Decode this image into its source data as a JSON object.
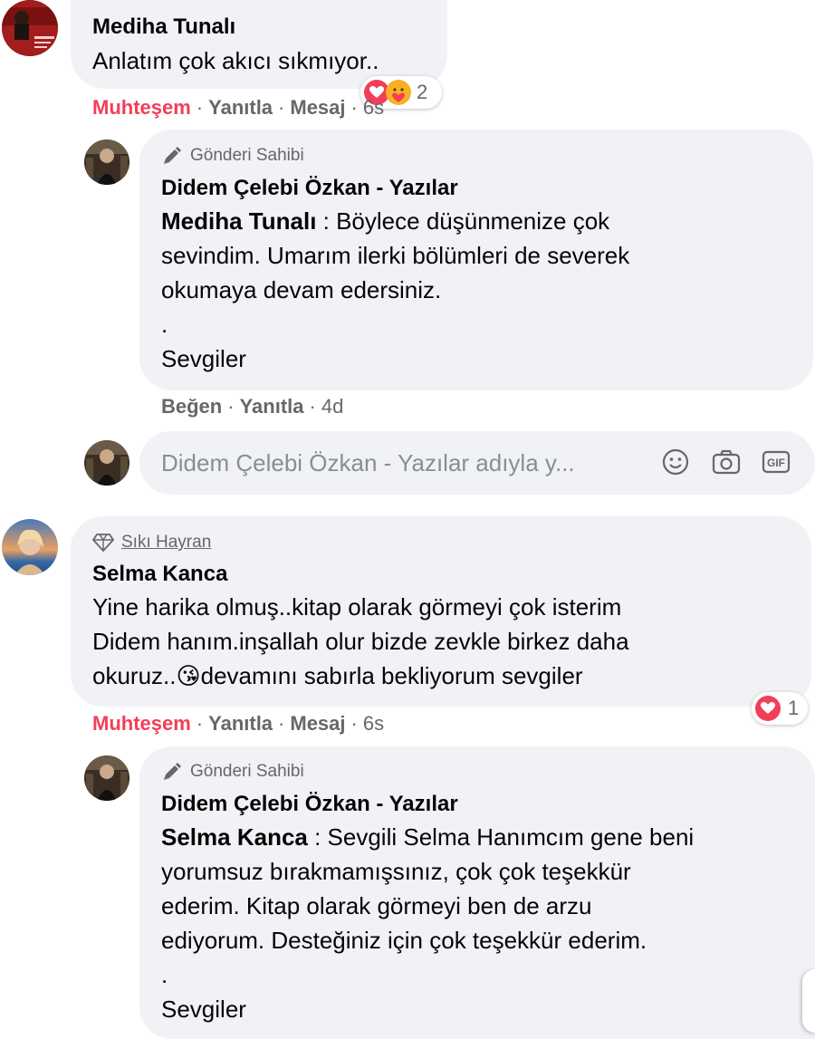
{
  "comments": [
    {
      "author": "Mediha Tunalı",
      "text": [
        "Anlatım çok akıcı sıkmıyor.."
      ],
      "actions": {
        "like": "Muhteşem",
        "reply": "Yanıtla",
        "message": "Mesaj",
        "time": "6s"
      },
      "reaction_count": "2",
      "reaction_icons": [
        "love-icon",
        "care-icon"
      ],
      "reply": {
        "badge": "Gönderi Sahibi",
        "author": "Didem Çelebi Özkan - Yazılar",
        "mention": "Mediha Tunalı",
        "lines": [
          " : Böylece düşünmenize çok",
          "sevindim. Umarım ilerki bölümleri de severek",
          "okumaya devam edersiniz.",
          ".",
          "Sevgiler"
        ],
        "actions": {
          "like": "Beğen",
          "reply": "Yanıtla",
          "time": "4d"
        }
      },
      "composer": {
        "placeholder": "Didem Çelebi Özkan - Yazılar adıyla y...",
        "icons": [
          "emoji-icon",
          "camera-icon",
          "gif-icon"
        ],
        "gif_label": "GIF"
      }
    },
    {
      "author": "Selma Kanca",
      "badge": "Sıkı Hayran",
      "text": [
        "Yine harika olmuş..kitap olarak görmeyi çok isterim",
        "Didem hanım.inşallah olur bizde zevkle birkez daha",
        "okuruz..",
        "devamını sabırla bekliyorum sevgiler"
      ],
      "emoji": "😘",
      "actions": {
        "like": "Muhteşem",
        "reply": "Yanıtla",
        "message": "Mesaj",
        "time": "6s"
      },
      "reaction_count": "1",
      "reaction_icons": [
        "love-icon"
      ],
      "reply": {
        "badge": "Gönderi Sahibi",
        "author": "Didem Çelebi Özkan - Yazılar",
        "mention": "Selma Kanca",
        "lines": [
          " : Sevgili Selma Hanımcım gene beni",
          "yorumsuz bırakmamışsınız, çok çok teşekkür",
          "ederim. Kitap olarak görmeyi ben de arzu",
          "ediyorum. Desteğiniz için çok teşekkür ederim.",
          ".",
          "Sevgiler"
        ]
      }
    }
  ],
  "colors": {
    "bubble": "#f0f2f5",
    "love": "#f33e58",
    "meta": "#65676b"
  }
}
